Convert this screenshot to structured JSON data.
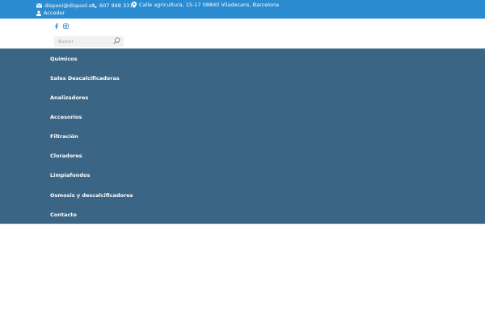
{
  "topbar": {
    "email": "dispool@dispool.es",
    "phone": "607 998 331",
    "address": "Calle agricultura, 15-17 08840 Viladecans, Barcelona",
    "login": "Acceder",
    "background_color": "#2b8bd0"
  },
  "social": {
    "icons": [
      "facebook-icon",
      "instagram-icon"
    ],
    "color": "#2b8bd0"
  },
  "search": {
    "placeholder": "Buscar",
    "icon": "search-icon"
  },
  "nav": {
    "background_color": "#3a6585",
    "items": [
      "Químicos",
      "Sales Descalcificadoras",
      "Analizadores",
      "Accesorios",
      "Filtración",
      "Cloradores",
      "Limpiafondos",
      "Osmosis y descalcificadores",
      "Contacto"
    ]
  }
}
